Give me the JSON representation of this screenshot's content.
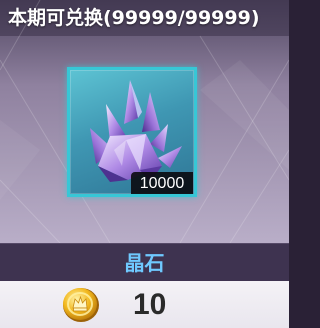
{
  "header": {
    "title": "本期可兑换(99999/99999)"
  },
  "item": {
    "icon": "purple-crystal-icon",
    "quantity": "10000",
    "name": "晶石",
    "frame_color": "#37c7d6",
    "name_color": "#6fc9ff"
  },
  "price": {
    "currency_icon": "gold-coin-icon",
    "amount": "10"
  }
}
